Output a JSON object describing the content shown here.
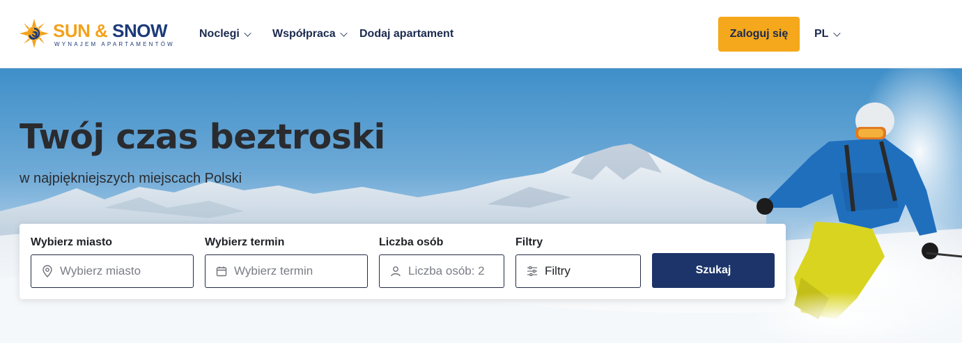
{
  "brand": {
    "name_part1": "SUN",
    "name_amp": "&",
    "name_part2": "SNOW",
    "tagline": "WYNAJEM APARTAMENTÓW",
    "colors": {
      "orange": "#f2a21c",
      "navy": "#1c3a78"
    }
  },
  "nav": {
    "items": [
      {
        "label": "Noclegi",
        "has_dropdown": true
      },
      {
        "label": "Współpraca",
        "has_dropdown": true
      },
      {
        "label": "Dodaj apartament",
        "has_dropdown": false
      }
    ],
    "login_label": "Zaloguj się",
    "language": "PL"
  },
  "hero": {
    "title": "Twój czas beztroski",
    "subtitle": "w najpiękniejszych miejscach Polski"
  },
  "search": {
    "city": {
      "label": "Wybierz miasto",
      "placeholder": "Wybierz miasto",
      "icon": "location-pin-icon"
    },
    "date": {
      "label": "Wybierz termin",
      "placeholder": "Wybierz termin",
      "icon": "calendar-icon"
    },
    "guests": {
      "label": "Liczba osób",
      "placeholder": "Liczba osób: 2",
      "icon": "person-icon"
    },
    "filters": {
      "label": "Filtry",
      "value": "Filtry",
      "icon": "sliders-icon"
    },
    "submit_label": "Szukaj"
  },
  "colors": {
    "accent": "#f5a81b",
    "primary": "#1c3469",
    "text": "#1b2a4e"
  }
}
